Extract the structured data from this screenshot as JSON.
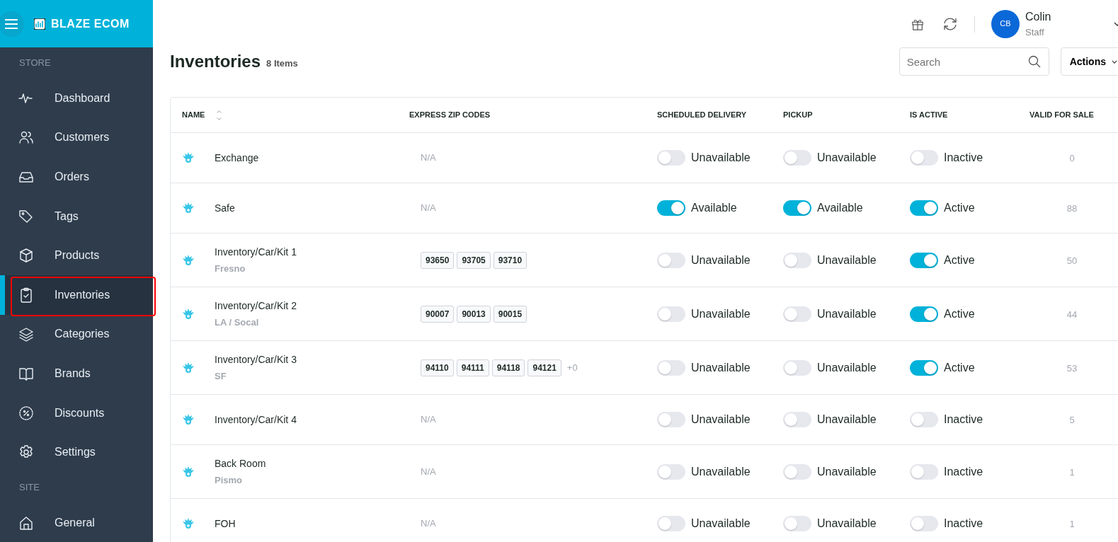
{
  "sidebar": {
    "logo": "BLAZE ECOM",
    "sections": [
      {
        "title": "STORE",
        "items": [
          {
            "label": "Dashboard",
            "kind": "pulse",
            "selected": false
          },
          {
            "label": "Customers",
            "kind": "users",
            "selected": false
          },
          {
            "label": "Orders",
            "kind": "inbox",
            "selected": false
          },
          {
            "label": "Tags",
            "kind": "tag",
            "selected": false
          },
          {
            "label": "Products",
            "kind": "box",
            "selected": false
          },
          {
            "label": "Inventories",
            "kind": "clipboard",
            "selected": true
          },
          {
            "label": "Categories",
            "kind": "layers",
            "selected": false
          },
          {
            "label": "Brands",
            "kind": "book",
            "selected": false
          },
          {
            "label": "Discounts",
            "kind": "percent",
            "selected": false
          },
          {
            "label": "Settings",
            "kind": "gear",
            "selected": false
          }
        ]
      },
      {
        "title": "SITE",
        "items": [
          {
            "label": "General",
            "kind": "home",
            "selected": false
          }
        ]
      }
    ]
  },
  "user": {
    "initials": "CB",
    "name": "Colin",
    "role": "Staff"
  },
  "page": {
    "title": "Inventories",
    "count": "8 Items",
    "search": {
      "placeholder": "Search"
    },
    "actions": "Actions"
  },
  "table": {
    "columns": [
      "NAME",
      "EXPRESS ZIP CODES",
      "SCHEDULED DELIVERY",
      "PICKUP",
      "IS ACTIVE",
      "VALID FOR SALE"
    ],
    "rows": [
      {
        "name": "Exchange",
        "express": "N/A",
        "scheduled": {
          "on": false,
          "label": "Unavailable"
        },
        "pickup": {
          "on": false,
          "label": "Unavailable"
        },
        "active": {
          "on": false,
          "label": "Inactive"
        },
        "valid": "0"
      },
      {
        "name": "Safe",
        "express": "N/A",
        "scheduled": {
          "on": true,
          "label": "Available"
        },
        "pickup": {
          "on": true,
          "label": "Available"
        },
        "active": {
          "on": true,
          "label": "Active"
        },
        "valid": "88"
      },
      {
        "name": "Inventory/Car/Kit 1",
        "location": "Fresno",
        "zip_codes": [
          "93650",
          "93705",
          "93710"
        ],
        "scheduled": {
          "on": false,
          "label": "Unavailable"
        },
        "pickup": {
          "on": false,
          "label": "Unavailable"
        },
        "active": {
          "on": true,
          "label": "Active"
        },
        "valid": "50"
      },
      {
        "name": "Inventory/Car/Kit 2",
        "location": "LA / Socal",
        "zip_codes": [
          "90007",
          "90013",
          "90015"
        ],
        "scheduled": {
          "on": false,
          "label": "Unavailable"
        },
        "pickup": {
          "on": false,
          "label": "Unavailable"
        },
        "active": {
          "on": true,
          "label": "Active"
        },
        "valid": "44"
      },
      {
        "name": "Inventory/Car/Kit 3",
        "location": "SF",
        "zip_codes": [
          "94110",
          "94111",
          "94118",
          "94121"
        ],
        "zip_more": "+0",
        "scheduled": {
          "on": false,
          "label": "Unavailable"
        },
        "pickup": {
          "on": false,
          "label": "Unavailable"
        },
        "active": {
          "on": true,
          "label": "Active"
        },
        "valid": "53"
      },
      {
        "name": "Inventory/Car/Kit 4",
        "express": "N/A",
        "scheduled": {
          "on": false,
          "label": "Unavailable"
        },
        "pickup": {
          "on": false,
          "label": "Unavailable"
        },
        "active": {
          "on": false,
          "label": "Inactive"
        },
        "valid": "5"
      },
      {
        "name": "Back Room",
        "location": "Pismo",
        "express": "N/A",
        "scheduled": {
          "on": false,
          "label": "Unavailable"
        },
        "pickup": {
          "on": false,
          "label": "Unavailable"
        },
        "active": {
          "on": false,
          "label": "Inactive"
        },
        "valid": "1"
      },
      {
        "name": "FOH",
        "express": "N/A",
        "scheduled": {
          "on": false,
          "label": "Unavailable"
        },
        "pickup": {
          "on": false,
          "label": "Unavailable"
        },
        "active": {
          "on": false,
          "label": "Inactive"
        },
        "valid": "1"
      }
    ]
  }
}
